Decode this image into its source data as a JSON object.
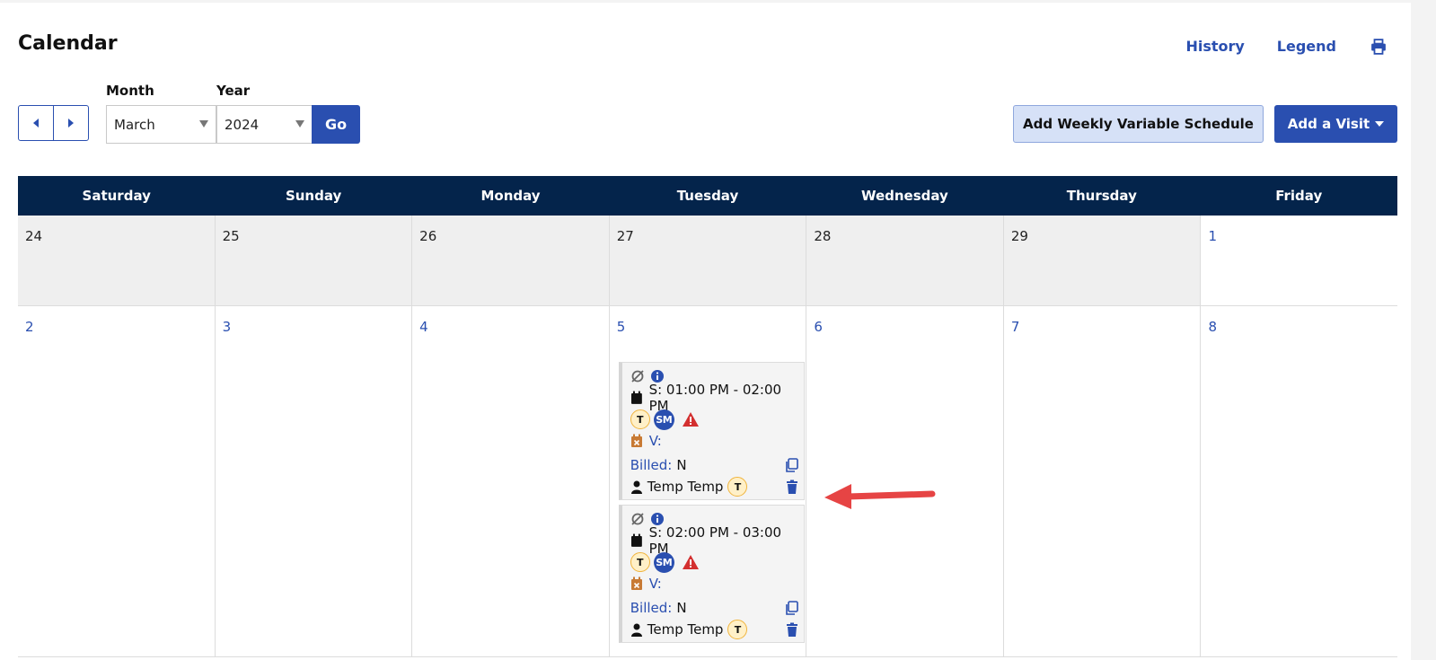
{
  "page": {
    "title": "Calendar",
    "links": {
      "history": "History",
      "legend": "Legend"
    }
  },
  "controls": {
    "month_label": "Month",
    "year_label": "Year",
    "month_value": "March",
    "year_value": "2024",
    "go": "Go",
    "weekly": "Add Weekly Variable Schedule",
    "add_visit": "Add a Visit"
  },
  "calendar": {
    "weekdays": [
      "Saturday",
      "Sunday",
      "Monday",
      "Tuesday",
      "Wednesday",
      "Thursday",
      "Friday"
    ],
    "week1": [
      "24",
      "25",
      "26",
      "27",
      "28",
      "29",
      "1"
    ],
    "week2": [
      "2",
      "3",
      "4",
      "5",
      "6",
      "7",
      "8"
    ]
  },
  "visits": [
    {
      "schedule": "S: 01:00 PM - 02:00 PM",
      "badge_t": "T",
      "badge_sm": "SM",
      "visit_label": "V:",
      "billed_label": "Billed:",
      "billed_value": "N",
      "caregiver": "Temp Temp",
      "caregiver_badge": "T"
    },
    {
      "schedule": "S: 02:00 PM - 03:00 PM",
      "badge_t": "T",
      "badge_sm": "SM",
      "visit_label": "V:",
      "billed_label": "Billed:",
      "billed_value": "N",
      "caregiver": "Temp Temp",
      "caregiver_badge": "T"
    }
  ],
  "colors": {
    "primary": "#2a4fb0",
    "header_bg": "#04244b",
    "alert": "#d32f2f",
    "arrow": "#e64444"
  }
}
